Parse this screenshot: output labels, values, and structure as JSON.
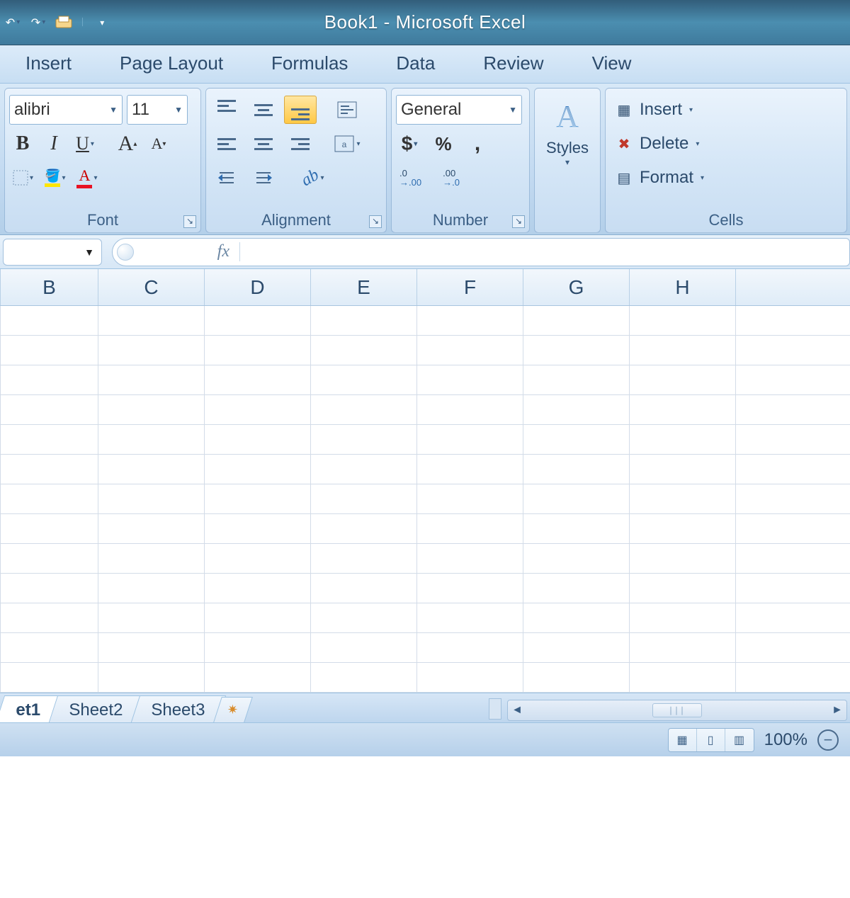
{
  "titlebar": {
    "title": "Book1 - Microsoft Excel"
  },
  "tabs": {
    "insert": "Insert",
    "page_layout": "Page Layout",
    "formulas": "Formulas",
    "data": "Data",
    "review": "Review",
    "view": "View"
  },
  "ribbon": {
    "font": {
      "title": "Font",
      "name": "alibri",
      "size": "11",
      "bold": "B",
      "italic": "I",
      "underline": "U",
      "grow": "A",
      "shrink": "A"
    },
    "alignment": {
      "title": "Alignment"
    },
    "number": {
      "title": "Number",
      "format": "General",
      "currency": "$",
      "percent": "%",
      "comma": ",",
      "inc": ".0 .00",
      "dec": ".00 .0"
    },
    "styles": {
      "label": "Styles"
    },
    "cells": {
      "title": "Cells",
      "insert": "Insert",
      "delete": "Delete",
      "format": "Format"
    }
  },
  "formula_bar": {
    "fx": "fx"
  },
  "columns": [
    "B",
    "C",
    "D",
    "E",
    "F",
    "G",
    "H"
  ],
  "sheets": {
    "s1": "et1",
    "s2": "Sheet2",
    "s3": "Sheet3"
  },
  "status": {
    "zoom": "100%"
  }
}
